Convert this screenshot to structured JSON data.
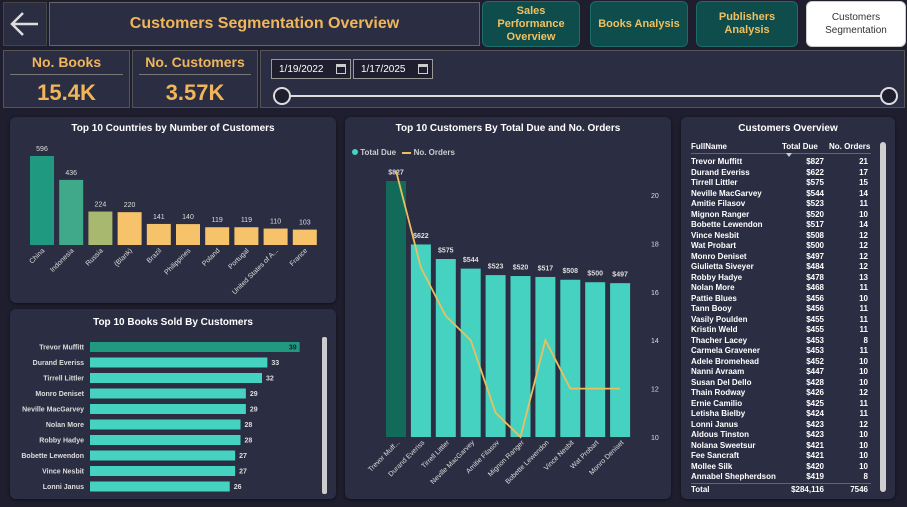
{
  "header": {
    "title": "Customers Segmentation Overview",
    "nav": [
      {
        "label": "Sales Performance Overview",
        "active": false
      },
      {
        "label": "Books Analysis",
        "active": false
      },
      {
        "label": "Publishers Analysis",
        "active": false
      },
      {
        "label": "Customers Segmentation",
        "active": true
      }
    ]
  },
  "kpis": {
    "books_label": "No. Books",
    "books_value": "15.4K",
    "customers_label": "No. Customers",
    "customers_value": "3.57K"
  },
  "date_slicer": {
    "start": "1/19/2022",
    "end": "1/17/2025"
  },
  "colors": {
    "accent": "#f0b65a",
    "teal": "#45d2c0",
    "teal_dark": "#126b58",
    "background": "#1e1e2e",
    "panel": "#2b2d42",
    "line": "#e8c060"
  },
  "countries_chart": {
    "title": "Top 10 Countries by Number of Customers"
  },
  "books_chart": {
    "title": "Top 10 Books Sold By Customers"
  },
  "combo_chart": {
    "title": "Top 10 Customers By Total Due and No. Orders",
    "legend_total": "Total Due",
    "legend_orders": "No. Orders"
  },
  "table": {
    "title": "Customers Overview",
    "headers": [
      "FullName",
      "Total Due",
      "No. Orders"
    ],
    "rows": [
      [
        "Trevor Muffitt",
        "$827",
        "21"
      ],
      [
        "Durand Everiss",
        "$622",
        "17"
      ],
      [
        "Tirrell Littler",
        "$575",
        "15"
      ],
      [
        "Neville MacGarvey",
        "$544",
        "14"
      ],
      [
        "Amitie Filasov",
        "$523",
        "11"
      ],
      [
        "Mignon Ranger",
        "$520",
        "10"
      ],
      [
        "Bobette Lewendon",
        "$517",
        "14"
      ],
      [
        "Vince Nesbit",
        "$508",
        "12"
      ],
      [
        "Wat Probart",
        "$500",
        "12"
      ],
      [
        "Monro Deniset",
        "$497",
        "12"
      ],
      [
        "Giulietta Siveyer",
        "$484",
        "12"
      ],
      [
        "Robby Hadye",
        "$478",
        "13"
      ],
      [
        "Nolan More",
        "$468",
        "11"
      ],
      [
        "Pattie Blues",
        "$456",
        "10"
      ],
      [
        "Tann Booy",
        "$456",
        "11"
      ],
      [
        "Vasily Poulden",
        "$455",
        "11"
      ],
      [
        "Kristin Weld",
        "$455",
        "11"
      ],
      [
        "Thacher Lacey",
        "$453",
        "8"
      ],
      [
        "Carmela Gravener",
        "$453",
        "11"
      ],
      [
        "Adele Bromehead",
        "$452",
        "10"
      ],
      [
        "Nanni Avraam",
        "$447",
        "10"
      ],
      [
        "Susan Del Dello",
        "$428",
        "10"
      ],
      [
        "Thain Rodway",
        "$426",
        "12"
      ],
      [
        "Ernie Camilio",
        "$425",
        "11"
      ],
      [
        "Letisha Bielby",
        "$424",
        "11"
      ],
      [
        "Lonni Janus",
        "$423",
        "12"
      ],
      [
        "Aldous Tinston",
        "$423",
        "10"
      ],
      [
        "Nolana Sweetsur",
        "$421",
        "10"
      ],
      [
        "Fee Sancraft",
        "$421",
        "10"
      ],
      [
        "Mollee Silk",
        "$420",
        "10"
      ],
      [
        "Annabel Shepherdson",
        "$419",
        "8"
      ]
    ],
    "total_label": "Total",
    "total_due": "$284,116",
    "total_orders": "7546"
  },
  "chart_data": [
    {
      "type": "bar",
      "title": "Top 10 Countries by Number of Customers",
      "categories": [
        "China",
        "Indonesia",
        "Russia",
        "(Blank)",
        "Brazil",
        "Philippines",
        "Poland",
        "Portugal",
        "United States of A...",
        "France"
      ],
      "values": [
        596,
        436,
        224,
        220,
        141,
        140,
        119,
        119,
        110,
        103
      ],
      "colors": [
        "#1f9a80",
        "#3fa98a",
        "#a9b86f",
        "#f6c36a",
        "#f6c36a",
        "#f6c36a",
        "#f6c36a",
        "#f6c36a",
        "#f6c36a",
        "#f6c36a"
      ],
      "ylim": [
        0,
        650
      ]
    },
    {
      "type": "bar",
      "orientation": "horizontal",
      "title": "Top 10 Books Sold By Customers",
      "categories": [
        "Trevor Muffitt",
        "Durand Everiss",
        "Tirrell Littler",
        "Monro Deniset",
        "Neville MacGarvey",
        "Nolan More",
        "Robby Hadye",
        "Bobette Lewendon",
        "Vince Nesbit",
        "Lonni Janus"
      ],
      "values": [
        39,
        33,
        32,
        29,
        29,
        28,
        28,
        27,
        27,
        26
      ],
      "xlim": [
        0,
        40
      ]
    },
    {
      "type": "bar",
      "title": "Top 10 Customers By Total Due and No. Orders",
      "categories": [
        "Trevor Muff...",
        "Durand Everiss",
        "Tirrell Littler",
        "Neville MacGarvey",
        "Amitie Filasov",
        "Mignon Ranger",
        "Bobette Lewendon",
        "Vince Nesbit",
        "Wat Probart",
        "Monro Deniset"
      ],
      "series": [
        {
          "name": "Total Due",
          "type": "bar",
          "values": [
            827,
            622,
            575,
            544,
            523,
            520,
            517,
            508,
            500,
            497
          ],
          "labels": [
            "$827",
            "$622",
            "$575",
            "$544",
            "$523",
            "$520",
            "$517",
            "$508",
            "$500",
            "$497"
          ]
        },
        {
          "name": "No. Orders",
          "type": "line",
          "values": [
            21,
            17,
            15,
            14,
            11,
            10,
            14,
            12,
            12,
            12
          ]
        }
      ],
      "ylim": [
        0,
        900
      ],
      "y2lim": [
        10,
        21
      ],
      "y2ticks": [
        10,
        12,
        14,
        16,
        18,
        20
      ]
    }
  ]
}
